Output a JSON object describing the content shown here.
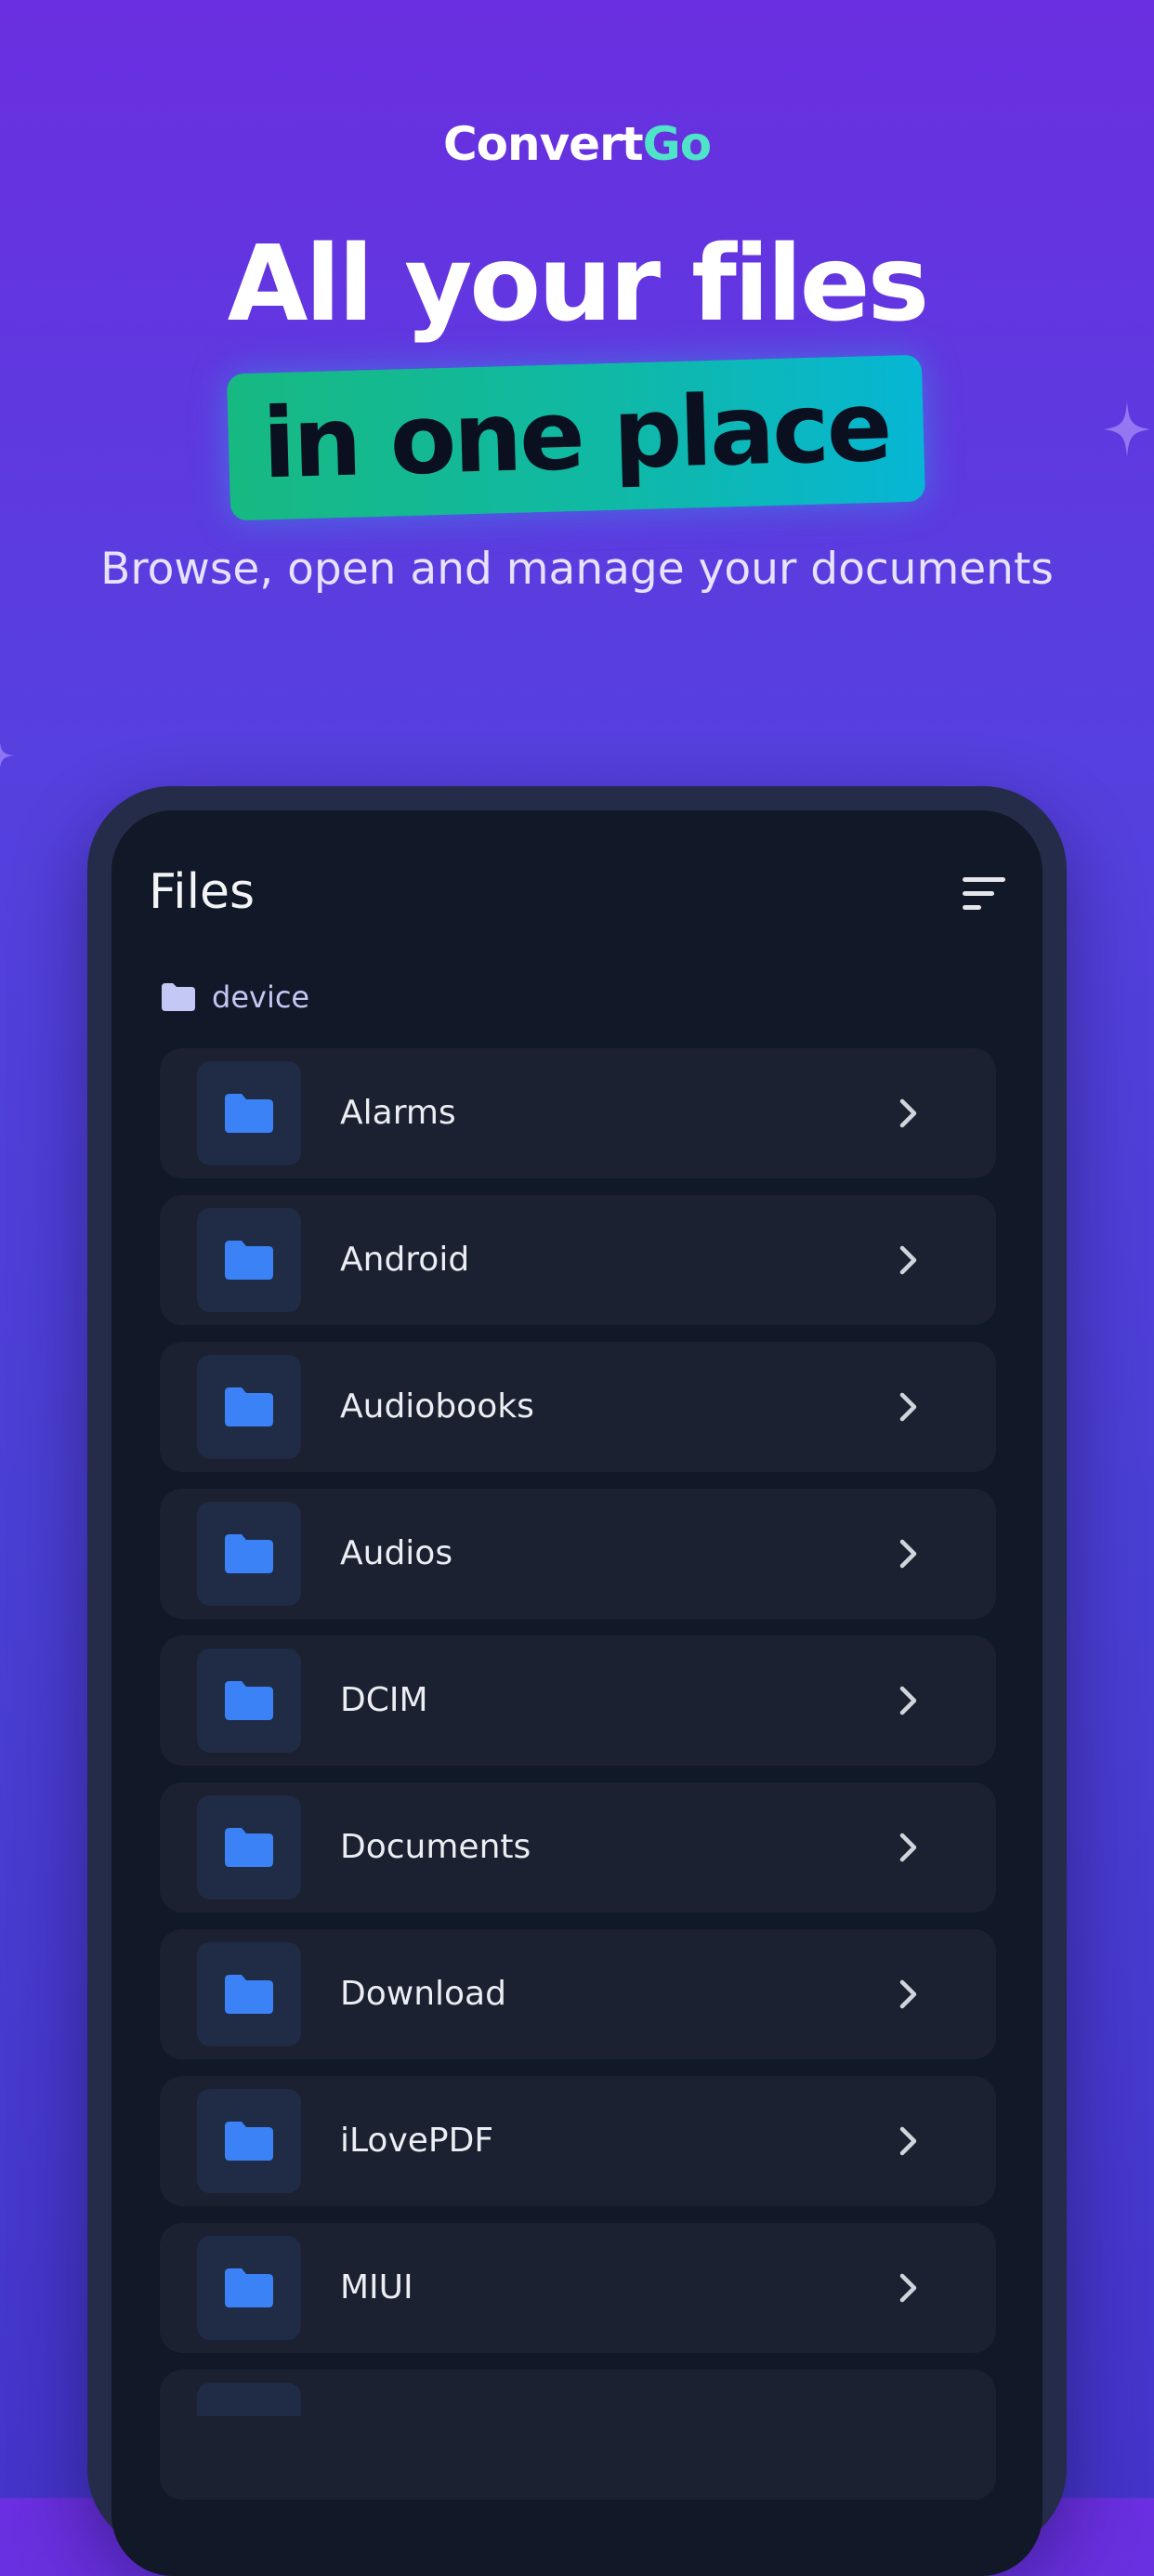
{
  "brand": {
    "name_part1": "Convert",
    "name_part2": "Go"
  },
  "headline": {
    "line1": "All your files",
    "line2": "in one place"
  },
  "subtitle": "Browse, open and manage your documents",
  "screen": {
    "title": "Files",
    "sort_icon": "sort-icon",
    "breadcrumb": {
      "icon": "folder-icon",
      "label": "device"
    },
    "folders": [
      {
        "name": "Alarms",
        "icon": "folder-icon"
      },
      {
        "name": "Android",
        "icon": "folder-icon"
      },
      {
        "name": "Audiobooks",
        "icon": "folder-icon"
      },
      {
        "name": "Audios",
        "icon": "folder-icon"
      },
      {
        "name": "DCIM",
        "icon": "folder-icon"
      },
      {
        "name": "Documents",
        "icon": "folder-icon"
      },
      {
        "name": "Download",
        "icon": "folder-icon"
      },
      {
        "name": "iLovePDF",
        "icon": "folder-icon"
      },
      {
        "name": "MIUI",
        "icon": "folder-icon"
      }
    ]
  },
  "colors": {
    "background_top": "#6a2fe0",
    "background_bottom": "#4335c9",
    "brand_accent": "#4fe3c8",
    "pill_start": "#17b981",
    "pill_end": "#06b6d4",
    "screen_bg": "#111827",
    "row_bg": "#1b2130",
    "folder_icon": "#3b82f6"
  }
}
